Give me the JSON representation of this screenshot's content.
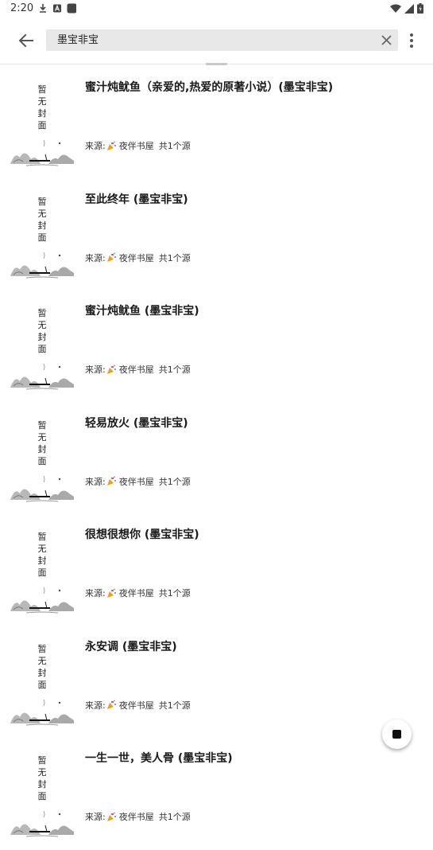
{
  "status_bar": {
    "time": "2:20",
    "icons": [
      "download-icon",
      "a-icon",
      "app-icon",
      "wifi-icon",
      "signal-icon",
      "battery-icon"
    ]
  },
  "toolbar": {
    "search_value": "墨宝非宝",
    "search_placeholder": ""
  },
  "results": [
    {
      "title": "蜜汁炖鱿鱼（亲爱的,热爱的原著小说）(墨宝非宝)",
      "source_label": "来源:",
      "source_name": "夜伴书屋",
      "source_count": "共1个源",
      "cover_text": [
        "暂",
        "无",
        "封",
        "面"
      ]
    },
    {
      "title": "至此终年 (墨宝非宝)",
      "source_label": "来源:",
      "source_name": "夜伴书屋",
      "source_count": "共1个源",
      "cover_text": [
        "暂",
        "无",
        "封",
        "面"
      ]
    },
    {
      "title": "蜜汁炖鱿鱼 (墨宝非宝)",
      "source_label": "来源:",
      "source_name": "夜伴书屋",
      "source_count": "共1个源",
      "cover_text": [
        "暂",
        "无",
        "封",
        "面"
      ]
    },
    {
      "title": "轻易放火 (墨宝非宝)",
      "source_label": "来源:",
      "source_name": "夜伴书屋",
      "source_count": "共1个源",
      "cover_text": [
        "暂",
        "无",
        "封",
        "面"
      ]
    },
    {
      "title": "很想很想你 (墨宝非宝)",
      "source_label": "来源:",
      "source_name": "夜伴书屋",
      "source_count": "共1个源",
      "cover_text": [
        "暂",
        "无",
        "封",
        "面"
      ]
    },
    {
      "title": "永安调 (墨宝非宝)",
      "source_label": "来源:",
      "source_name": "夜伴书屋",
      "source_count": "共1个源",
      "cover_text": [
        "暂",
        "无",
        "封",
        "面"
      ]
    },
    {
      "title": "一生一世，美人骨 (墨宝非宝)",
      "source_label": "来源:",
      "source_name": "夜伴书屋",
      "source_count": "共1个源",
      "cover_text": [
        "暂",
        "无",
        "封",
        "面"
      ]
    }
  ],
  "colors": {
    "search_bg": "#e8e8e8",
    "fab_bg": "#ffffff",
    "text_dark": "#1a1a1a"
  }
}
